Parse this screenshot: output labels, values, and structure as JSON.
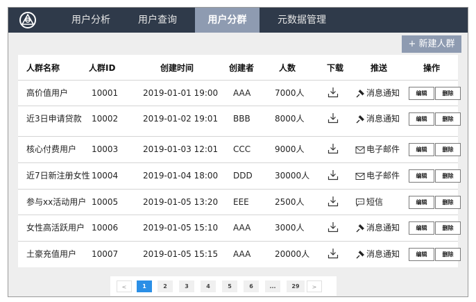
{
  "nav": {
    "tabs": [
      {
        "label": "用户分析"
      },
      {
        "label": "用户查询"
      },
      {
        "label": "用户分群"
      },
      {
        "label": "元数据管理"
      }
    ]
  },
  "actions": {
    "new_group": "+ 新建人群"
  },
  "table": {
    "headers": {
      "name": "人群名称",
      "id": "人群ID",
      "created_at": "创建时间",
      "creator": "创建者",
      "count": "人数",
      "download": "下载",
      "push": "推送",
      "ops": "操作"
    },
    "edit_label": "编辑",
    "delete_label": "删除",
    "rows": [
      {
        "name": "高价值用户",
        "id": "10001",
        "created_at": "2019-01-01 19:00",
        "creator": "AAA",
        "count": "7000人",
        "push_icon": "pin-icon",
        "push": "消息通知"
      },
      {
        "name": "近3日申请贷款",
        "id": "10002",
        "created_at": "2019-01-02 19:01",
        "creator": "BBB",
        "count": "8000人",
        "push_icon": "pin-icon",
        "push": "消息通知"
      },
      {
        "name": "核心付费用户",
        "id": "10003",
        "created_at": "2019-01-03 12:01",
        "creator": "CCC",
        "count": "9000人",
        "push_icon": "mail-icon",
        "push": "电子邮件"
      },
      {
        "name": "近7日新注册女性",
        "id": "10004",
        "created_at": "2019-01-04 18:00",
        "creator": "DDD",
        "count": "30000人",
        "push_icon": "mail-icon",
        "push": "电子邮件"
      },
      {
        "name": "参与xx活动用户",
        "id": "10005",
        "created_at": "2019-01-05 13:20",
        "creator": "EEE",
        "count": "2500人",
        "push_icon": "chat-icon",
        "push": "短信"
      },
      {
        "name": "女性高活跃用户",
        "id": "10006",
        "created_at": "2019-01-05 15:10",
        "creator": "AAA",
        "count": "3000人",
        "push_icon": "pin-icon",
        "push": "消息通知"
      },
      {
        "name": "土豪充值用户",
        "id": "10007",
        "created_at": "2019-01-05 15:15",
        "creator": "AAA",
        "count": "20000人",
        "push_icon": "pin-icon",
        "push": "消息通知"
      }
    ]
  },
  "pagination": {
    "prev": "<",
    "pages": [
      "1",
      "2",
      "3",
      "4",
      "5",
      "6",
      "...",
      "29"
    ],
    "current": "1",
    "next": ">"
  },
  "colors": {
    "nav_bg": "#2f3a4a",
    "tab_active_bg": "#8e9bb1",
    "page_active_bg": "#2b8fe6"
  }
}
